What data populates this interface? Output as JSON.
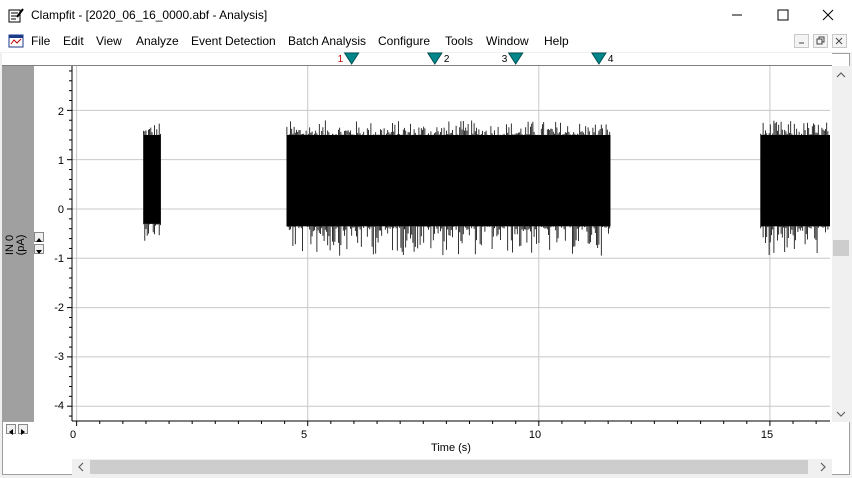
{
  "window": {
    "title": "Clampfit - [2020_06_16_0000.abf - Analysis]",
    "controls": [
      "minimize",
      "maximize",
      "close"
    ]
  },
  "menu": {
    "items": [
      "File",
      "Edit",
      "View",
      "Analyze",
      "Event Detection",
      "Batch Analysis",
      "Configure",
      "Tools",
      "Window",
      "Help"
    ]
  },
  "cursors": [
    {
      "label": "1",
      "label_side": "left",
      "label_color": "#c00000",
      "x": 5.95
    },
    {
      "label": "2",
      "label_side": "right",
      "label_color": "#000000",
      "x": 7.75
    },
    {
      "label": "3",
      "label_side": "left",
      "label_color": "#000000",
      "x": 9.5
    },
    {
      "label": "4",
      "label_side": "right",
      "label_color": "#000000",
      "x": 11.3
    }
  ],
  "chart_data": {
    "type": "line",
    "title": "",
    "xlabel": "Time (s)",
    "ylabel": "IN 0 (pA)",
    "xlim": [
      -0.1,
      16.3
    ],
    "ylim": [
      -4.3,
      2.9
    ],
    "xticks": [
      0,
      5,
      10,
      15
    ],
    "yticks": [
      2,
      1,
      0,
      -1,
      -2,
      -3,
      -4
    ],
    "grid": true,
    "trace_color": "#000000",
    "grid_color": "#c8c8c8",
    "series": [
      {
        "segments": [
          {
            "x_start": 1.45,
            "x_end": 1.82,
            "low": -0.3,
            "high": 1.5,
            "min_spike": -0.65,
            "max_spike": 1.8
          },
          {
            "x_start": 4.55,
            "x_end": 11.55,
            "low": -0.35,
            "high": 1.5,
            "min_spike": -0.95,
            "max_spike": 1.8
          },
          {
            "x_start": 14.8,
            "x_end": 16.3,
            "low": -0.35,
            "high": 1.5,
            "min_spike": -0.95,
            "max_spike": 1.8
          }
        ]
      }
    ]
  }
}
